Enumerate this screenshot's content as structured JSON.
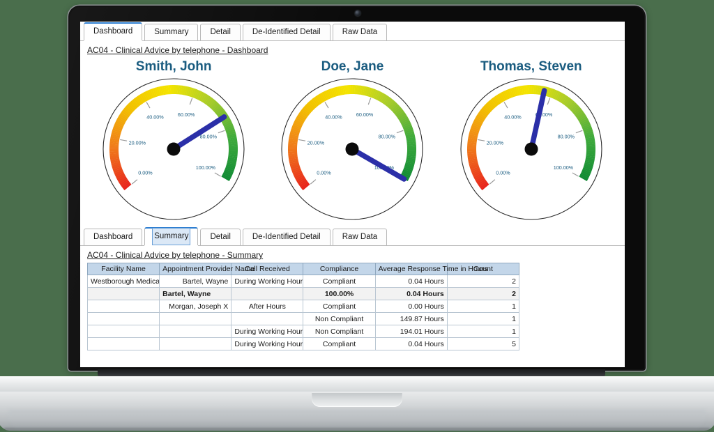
{
  "window": {
    "device": "laptop",
    "background_color": "#4a6e4c",
    "accent_color": "#2f7fd1",
    "title_color": "#1a5c80"
  },
  "dashboard_panel": {
    "tabs": [
      {
        "label": "Dashboard",
        "selected": true,
        "focused": false
      },
      {
        "label": "Summary",
        "selected": false,
        "focused": false
      },
      {
        "label": "Detail",
        "selected": false,
        "focused": false
      },
      {
        "label": "De-Identified Detail",
        "selected": false,
        "focused": false
      },
      {
        "label": "Raw Data",
        "selected": false,
        "focused": false
      }
    ],
    "report_title": "AC04 -  Clinical Advice by telephone - Dashboard"
  },
  "summary_panel": {
    "tabs": [
      {
        "label": "Dashboard",
        "selected": false,
        "focused": false
      },
      {
        "label": "Summary",
        "selected": true,
        "focused": true
      },
      {
        "label": "Detail",
        "selected": false,
        "focused": false
      },
      {
        "label": "De-Identified Detail",
        "selected": false,
        "focused": false
      },
      {
        "label": "Raw Data",
        "selected": false,
        "focused": false
      }
    ],
    "report_title": "AC04 -  Clinical Advice by telephone  - Summary"
  },
  "chart_data": [
    {
      "type": "gauge",
      "title": "Smith, John",
      "value": 75,
      "min": 0,
      "max": 100,
      "unit": "%",
      "tick_labels": [
        "0.00%",
        "20.00%",
        "40.00%",
        "60.00%",
        "80.00%",
        "100.00%"
      ],
      "tick_values": [
        0,
        20,
        40,
        60,
        80,
        100
      ],
      "needle_color": "#2b2fa8",
      "band_colors": [
        "#e8241c",
        "#f07c1a",
        "#f2c200",
        "#f4e400",
        "#a8cc2a",
        "#3faa3c",
        "#0f8a34"
      ]
    },
    {
      "type": "gauge",
      "title": "Doe, Jane",
      "value": 100,
      "min": 0,
      "max": 100,
      "unit": "%",
      "tick_labels": [
        "0.00%",
        "20.00%",
        "40.00%",
        "60.00%",
        "80.00%",
        "100.00%"
      ],
      "tick_values": [
        0,
        20,
        40,
        60,
        80,
        100
      ],
      "needle_color": "#2b2fa8",
      "band_colors": [
        "#e8241c",
        "#f07c1a",
        "#f2c200",
        "#f4e400",
        "#a8cc2a",
        "#3faa3c",
        "#0f8a34"
      ]
    },
    {
      "type": "gauge",
      "title": "Thomas, Steven",
      "value": 57,
      "min": 0,
      "max": 100,
      "unit": "%",
      "tick_labels": [
        "0.00%",
        "20.00%",
        "40.00%",
        "60.00%",
        "80.00%",
        "100.00%"
      ],
      "tick_values": [
        0,
        20,
        40,
        60,
        80,
        100
      ],
      "needle_color": "#2b2fa8",
      "band_colors": [
        "#e8241c",
        "#f07c1a",
        "#f2c200",
        "#f4e400",
        "#a8cc2a",
        "#3faa3c",
        "#0f8a34"
      ]
    }
  ],
  "summary_table": {
    "columns": [
      "Facility Name",
      "Appointment Provider Name",
      "Call Received",
      "Compliance",
      "Average Response Time in Hours",
      "Count"
    ],
    "rows": [
      {
        "type": "data",
        "facility": "Westborough Medical Clinic",
        "provider": "Bartel, Wayne",
        "call_received": "During Working Hours",
        "compliance": "Compliant",
        "avg_response": "0.04 Hours",
        "count": "2"
      },
      {
        "type": "subtotal",
        "facility": "",
        "provider": "Bartel, Wayne",
        "call_received": "",
        "compliance": "100.00%",
        "avg_response": "0.04 Hours",
        "count": "2"
      },
      {
        "type": "data",
        "facility": "",
        "provider": "Morgan, Joseph X",
        "call_received": "After Hours",
        "compliance": "Compliant",
        "avg_response": "0.00 Hours",
        "count": "1"
      },
      {
        "type": "data",
        "facility": "",
        "provider": "",
        "call_received": "",
        "compliance": "Non Compliant",
        "avg_response": "149.87 Hours",
        "count": "1"
      },
      {
        "type": "data",
        "facility": "",
        "provider": "",
        "call_received": "During Working Hours",
        "compliance": "Non Compliant",
        "avg_response": "194.01 Hours",
        "count": "1"
      },
      {
        "type": "data",
        "facility": "",
        "provider": "",
        "call_received": "During Working Hours",
        "compliance": "Compliant",
        "avg_response": "0.04 Hours",
        "count": "5"
      }
    ]
  }
}
